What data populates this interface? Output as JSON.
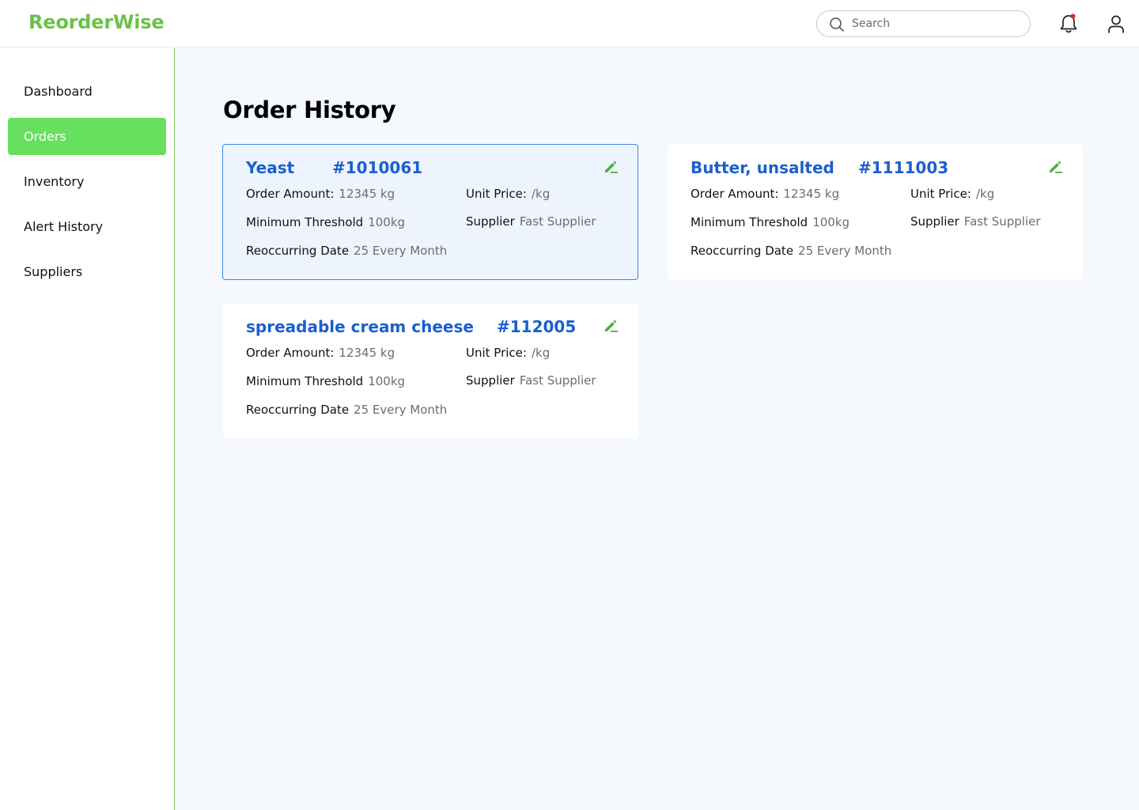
{
  "app": {
    "brand": "ReorderWise"
  },
  "search": {
    "placeholder": "Search"
  },
  "sidebar": {
    "items": [
      {
        "label": "Dashboard"
      },
      {
        "label": "Orders",
        "active": true
      },
      {
        "label": "Inventory"
      },
      {
        "label": "Alert History"
      },
      {
        "label": "Suppliers"
      }
    ]
  },
  "main": {
    "title": "Order History"
  },
  "orders": [
    {
      "name": "Yeast",
      "id": "#1010061",
      "selected": true,
      "order_amount_label": "Order Amount:",
      "order_amount": "12345 kg",
      "unit_price_label": "Unit Price:",
      "unit_price": "/kg",
      "min_threshold_label": "Minimum Threshold",
      "min_threshold": "100kg",
      "supplier_label": "Supplier",
      "supplier": "Fast Supplier",
      "reoccurring_label": "Reoccurring Date",
      "reoccurring": "25 Every Month"
    },
    {
      "name": "Butter, unsalted",
      "id": "#1111003",
      "selected": false,
      "order_amount_label": "Order Amount:",
      "order_amount": "12345 kg",
      "unit_price_label": "Unit Price:",
      "unit_price": "/kg",
      "min_threshold_label": "Minimum Threshold",
      "min_threshold": "100kg",
      "supplier_label": "Supplier",
      "supplier": "Fast Supplier",
      "reoccurring_label": "Reoccurring Date",
      "reoccurring": "25 Every Month"
    },
    {
      "name": "spreadable cream cheese",
      "id": "#112005",
      "selected": false,
      "order_amount_label": "Order Amount:",
      "order_amount": "12345 kg",
      "unit_price_label": "Unit Price:",
      "unit_price": "/kg",
      "min_threshold_label": "Minimum Threshold",
      "min_threshold": "100kg",
      "supplier_label": "Supplier",
      "supplier": "Fast Supplier",
      "reoccurring_label": "Reoccurring Date",
      "reoccurring": "25 Every Month"
    }
  ],
  "icons": {
    "search": "search-icon",
    "notifications": "bell-icon",
    "profile": "user-icon",
    "edit": "edit-pencil-icon"
  },
  "colors": {
    "brand_green": "#6cc04a",
    "active_nav": "#66e05e",
    "title_blue": "#1a5fd0",
    "notification_dot": "#e02424",
    "edit_icon": "#4caf3c"
  }
}
